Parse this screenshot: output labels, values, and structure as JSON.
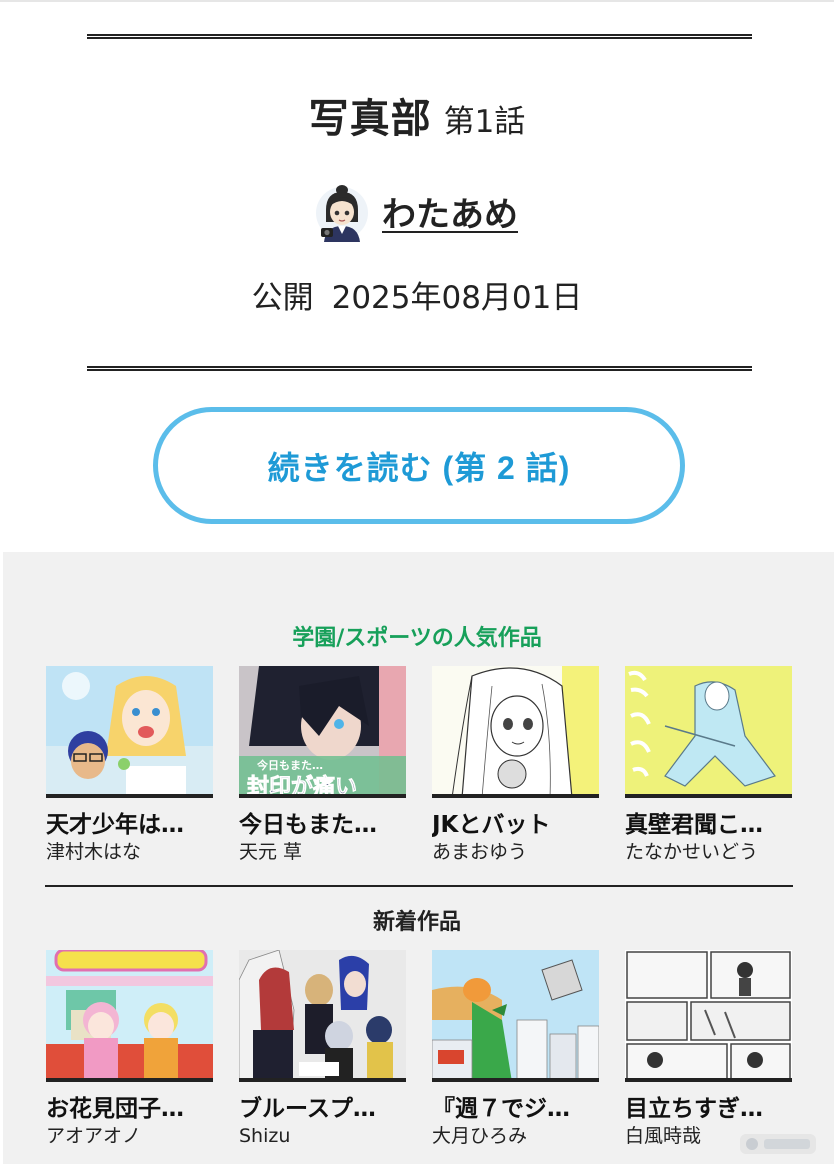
{
  "episode": {
    "series_title": "写真部",
    "episode_label": "第1話",
    "author": "わたあめ",
    "publish_label": "公開",
    "publish_date": "2025年08月01日"
  },
  "continue_button": {
    "label": "続きを読む (第 2 話)"
  },
  "popular_section": {
    "title": "学園/スポーツの人気作品",
    "items": [
      {
        "title": "天才少年は…",
        "author": "津村木はな"
      },
      {
        "title": "今日もまた…",
        "author": "天元 草"
      },
      {
        "title": "JKとバット",
        "author": "あまおゆう"
      },
      {
        "title": "真壁君聞こ…",
        "author": "たなかせいどう"
      }
    ]
  },
  "new_section": {
    "title": "新着作品",
    "items": [
      {
        "title": "お花見団子…",
        "author": "アオアオノ"
      },
      {
        "title": "ブルースプ…",
        "author": "Shizu"
      },
      {
        "title": "『週７でジ…",
        "author": "大月ひろみ"
      },
      {
        "title": "目立ちすぎ…",
        "author": "白風時哉"
      }
    ]
  },
  "thumbnail_text": {
    "popular_2_line1": "今日もまた…",
    "popular_2_line2": "封印が痛い"
  },
  "colors": {
    "accent_blue": "#1e9ad6",
    "button_border": "#5bbdea",
    "popular_green": "#17a05a",
    "panel_bg": "#f1f1f1"
  }
}
